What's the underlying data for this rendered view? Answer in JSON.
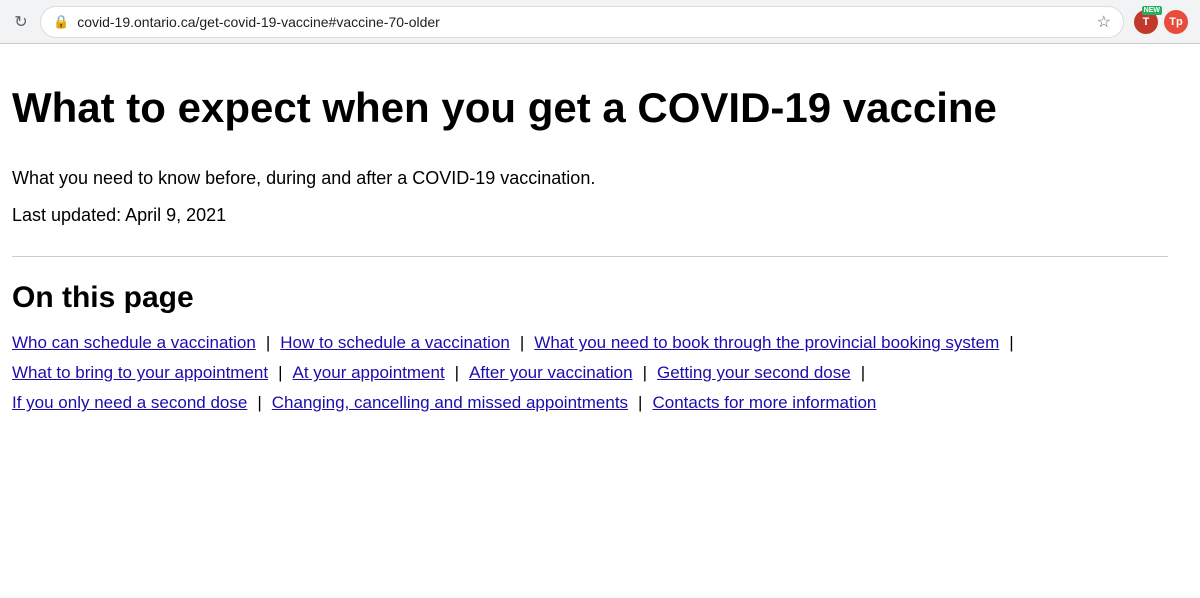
{
  "browser": {
    "url": "covid-19.ontario.ca/get-covid-19-vaccine#vaccine-70-older",
    "reload_label": "↻",
    "lock_symbol": "🔒",
    "star_symbol": "☆",
    "ext1_label": "T",
    "ext2_label": "NEW",
    "ext3_label": "Tp"
  },
  "page": {
    "title": "What to expect when you get a COVID-19 vaccine",
    "subtitle": "What you need to know before, during and after a COVID-19 vaccination.",
    "last_updated": "Last updated: April 9, 2021",
    "on_this_page_heading": "On this page"
  },
  "nav_rows": [
    {
      "id": "row1",
      "links": [
        {
          "id": "link-who-can-schedule",
          "text": "Who can schedule a vaccination"
        },
        {
          "id": "link-how-to-schedule",
          "text": "How to schedule a vaccination"
        },
        {
          "id": "link-what-you-need",
          "text": "What you need to book through the provincial booking system"
        }
      ]
    },
    {
      "id": "row2",
      "links": [
        {
          "id": "link-what-to-bring",
          "text": "What to bring to your appointment"
        },
        {
          "id": "link-at-your-appointment",
          "text": "At your appointment"
        },
        {
          "id": "link-after-vaccination",
          "text": "After your vaccination"
        },
        {
          "id": "link-second-dose",
          "text": "Getting your second dose"
        }
      ]
    },
    {
      "id": "row3",
      "links": [
        {
          "id": "link-only-second-dose",
          "text": "If you only need a second dose"
        },
        {
          "id": "link-changing",
          "text": "Changing, cancelling and missed appointments"
        },
        {
          "id": "link-contacts",
          "text": "Contacts for more information"
        }
      ]
    }
  ]
}
